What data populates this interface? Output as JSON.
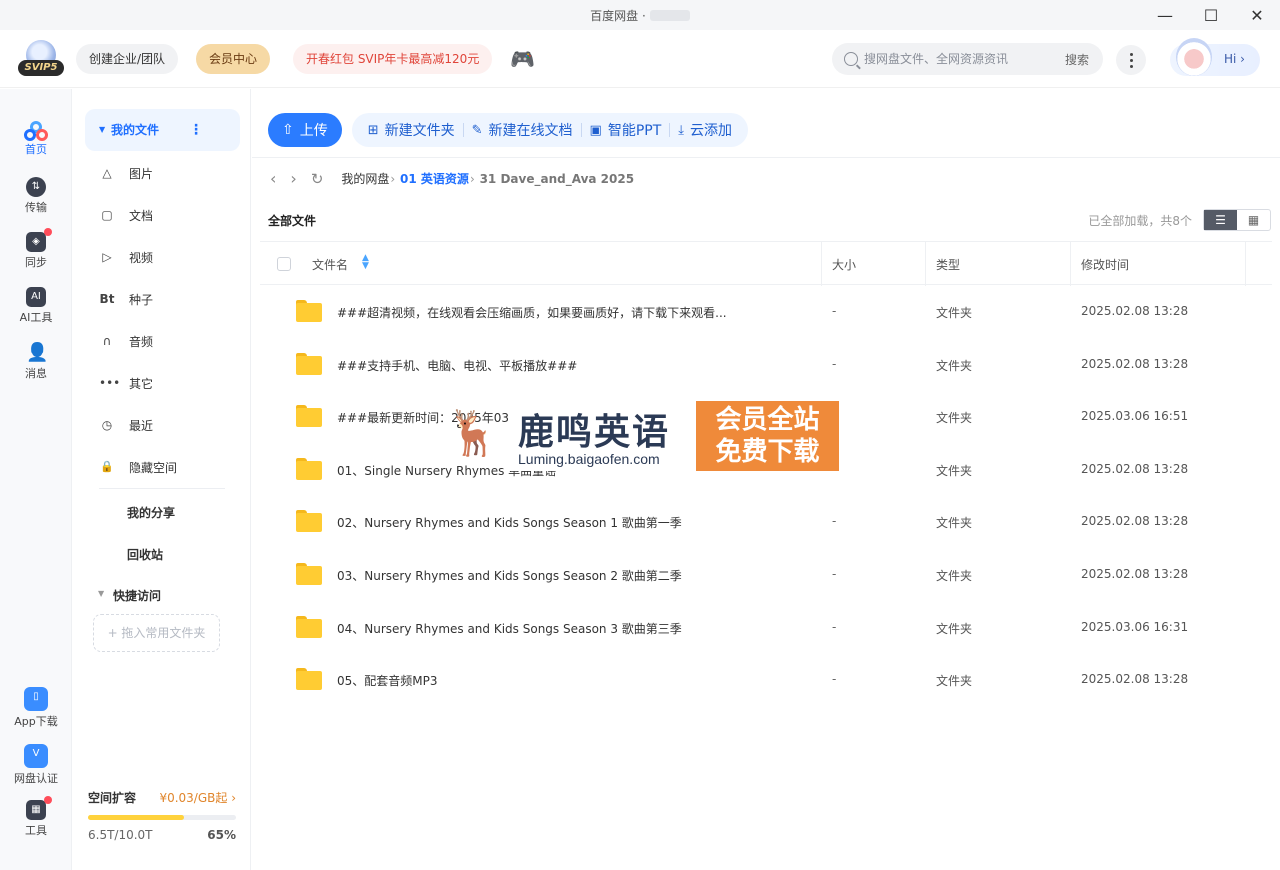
{
  "window": {
    "title": "百度网盘 ·",
    "controls": [
      "—",
      "☐",
      "✕"
    ]
  },
  "header": {
    "svip_badge": "SVIP5",
    "team_label": "创建企业/团队",
    "vip_center_label": "会员中心",
    "promo_label": "开春红包 SVIP年卡最高减120元",
    "game_icon": "🎮",
    "search": {
      "placeholder": "搜网盘文件、全网资源资讯",
      "button": "搜索"
    },
    "greeting": "Hi ›"
  },
  "rail": {
    "items": [
      {
        "label": "首页",
        "icon": "home-logo-icon",
        "active": true
      },
      {
        "label": "传输",
        "icon": "transfer-icon"
      },
      {
        "label": "同步",
        "icon": "sync-icon",
        "dot": true
      },
      {
        "label": "AI工具",
        "icon": "ai-tools-icon"
      },
      {
        "label": "消息",
        "icon": "message-icon"
      },
      {
        "label": "App下载",
        "icon": "app-download-icon"
      },
      {
        "label": "网盘认证",
        "icon": "verify-icon"
      },
      {
        "label": "工具",
        "icon": "tools-icon",
        "dot": true
      }
    ]
  },
  "sidebar": {
    "my_files": "我的文件",
    "categories": [
      {
        "label": "图片",
        "icon": "△"
      },
      {
        "label": "文档",
        "icon": "▢"
      },
      {
        "label": "视频",
        "icon": "▷"
      },
      {
        "label": "种子",
        "icon": "Bt"
      },
      {
        "label": "音频",
        "icon": "∩"
      },
      {
        "label": "其它",
        "icon": "•••"
      },
      {
        "label": "最近",
        "icon": "◷"
      },
      {
        "label": "隐藏空间",
        "icon": "🔒"
      }
    ],
    "my_share": "我的分享",
    "recycle": "回收站",
    "quick_access": "快捷访问",
    "drop_hint": "+ 拖入常用文件夹",
    "storage": {
      "title": "空间扩容",
      "price": "¥0.03/GB起 ›",
      "used": "6.5T/10.0T",
      "percent_label": "65%",
      "percent": 0.65,
      "fill_color": "#ffd23c"
    }
  },
  "toolbar": {
    "upload": "上传",
    "new_folder": "新建文件夹",
    "new_doc": "新建在线文档",
    "smart_ppt": "智能PPT",
    "cloud_add": "云添加"
  },
  "path": {
    "root": "我的网盘",
    "level1": "01 英语资源",
    "level2": "31 Dave_and_Ava 2025"
  },
  "list": {
    "all_files": "全部文件",
    "loaded_text": "已全部加载，共8个",
    "columns": {
      "name": "文件名",
      "size": "大小",
      "type": "类型",
      "modified": "修改时间"
    },
    "rows": [
      {
        "name": "###超清视频，在线观看会压缩画质，如果要画质好，请下载下来观看...",
        "size": "-",
        "type": "文件夹",
        "modified": "2025.02.08 13:28"
      },
      {
        "name": "###支持手机、电脑、电视、平板播放###",
        "size": "-",
        "type": "文件夹",
        "modified": "2025.02.08 13:28"
      },
      {
        "name": "###最新更新时间：2025年03月",
        "size": "-",
        "type": "文件夹",
        "modified": "2025.03.06 16:51"
      },
      {
        "name": "01、Single Nursery Rhymes 单曲童谣",
        "size": "-",
        "type": "文件夹",
        "modified": "2025.02.08 13:28"
      },
      {
        "name": "02、Nursery Rhymes and Kids Songs Season 1 歌曲第一季",
        "size": "-",
        "type": "文件夹",
        "modified": "2025.02.08 13:28"
      },
      {
        "name": "03、Nursery Rhymes and Kids Songs Season 2 歌曲第二季",
        "size": "-",
        "type": "文件夹",
        "modified": "2025.02.08 13:28"
      },
      {
        "name": "04、Nursery Rhymes and Kids Songs Season 3 歌曲第三季",
        "size": "-",
        "type": "文件夹",
        "modified": "2025.03.06 16:31"
      },
      {
        "name": "05、配套音频MP3",
        "size": "-",
        "type": "文件夹",
        "modified": "2025.02.08 13:28"
      }
    ]
  },
  "watermark": {
    "brand": "鹿鸣英语",
    "url": "Luming.baigaofen.com",
    "tag_line1": "会员全站",
    "tag_line2": "免费下载"
  },
  "colors": {
    "accent": "#2b7cff",
    "folder": "#ffcc33",
    "watermark": "#ef8a3a"
  }
}
